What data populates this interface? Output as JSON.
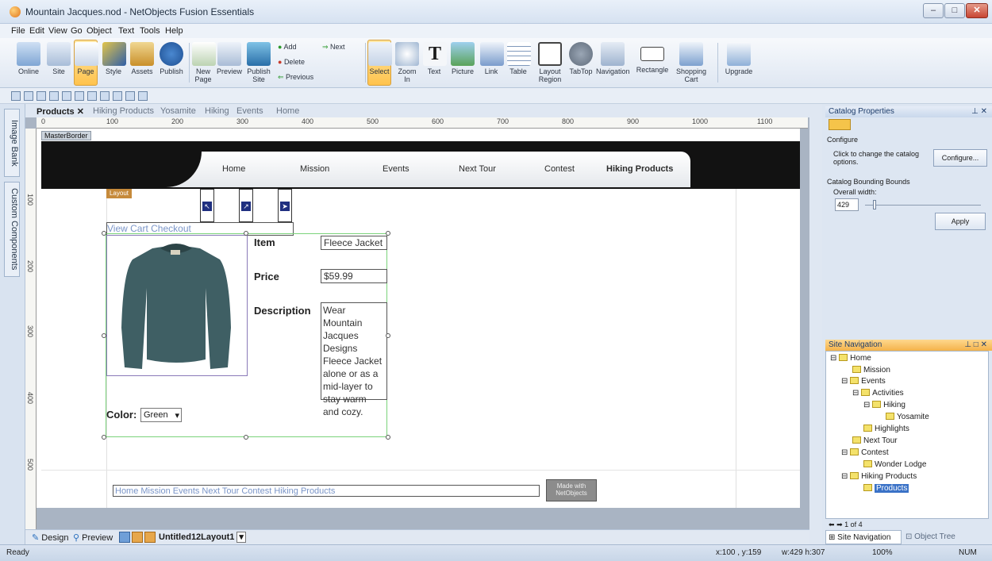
{
  "app": {
    "title": "Mountain Jacques.nod - NetObjects Fusion Essentials"
  },
  "menu": [
    "File",
    "Edit",
    "View",
    "Go",
    "Object",
    "Text",
    "Tools",
    "Help"
  ],
  "ribbon": {
    "left_buttons": [
      "Online",
      "Site",
      "Page",
      "Style",
      "Assets",
      "Publish"
    ],
    "page_buttons": [
      "New Page",
      "Preview",
      "Publish Site"
    ],
    "add_label": "Add",
    "delete_label": "Delete",
    "next_label": "Next",
    "previous_label": "Previous",
    "tools": [
      "Select",
      "Zoom In",
      "Text",
      "Picture",
      "Link",
      "Table",
      "Layout Region",
      "TabTop",
      "Navigation",
      "Rectangle",
      "Shopping Cart"
    ],
    "upgrade": "Upgrade"
  },
  "sidebar_tabs": [
    "Image Bank",
    "Custom Components"
  ],
  "doc_tabs": [
    "Products",
    "Hiking Products",
    "Yosamite",
    "Hiking",
    "Events",
    "Home"
  ],
  "ruler": {
    "h": [
      "0",
      "100",
      "200",
      "300",
      "400",
      "500",
      "600",
      "700",
      "800",
      "900",
      "1000",
      "1100"
    ],
    "v": [
      "100",
      "200",
      "300",
      "400",
      "500"
    ]
  },
  "page": {
    "masterborder_label": "MasterBorder",
    "layout_label": "Layout",
    "nav": [
      "Home",
      "Mission",
      "Events",
      "Next Tour",
      "Contest",
      "Hiking Products"
    ],
    "cart_links": "View Cart  Checkout",
    "item_label": "Item",
    "item_value": "Fleece Jacket",
    "price_label": "Price",
    "price_value": "$59.99",
    "description_label": "Description",
    "description_value": "Wear Mountain Jacques Designs Fleece Jacket alone or as a mid-layer to stay warm and cozy.",
    "color_label": "Color:",
    "color_value": "Green",
    "footer_links": "Home  Mission  Events  Next Tour  Contest  Hiking Products",
    "badge": "Made with NetObjects"
  },
  "bottom": {
    "design": "Design",
    "preview": "Preview",
    "layout_select": "Untitled12Layout1"
  },
  "catalog": {
    "title": "Catalog Properties",
    "configure_header": "Configure",
    "configure_text": "Click to change the catalog options.",
    "configure_button": "Configure...",
    "bounds_header": "Catalog Bounding Bounds",
    "overall_width_label": "Overall width:",
    "overall_width_value": "429",
    "apply_button": "Apply"
  },
  "site_nav": {
    "title": "Site Navigation",
    "tree": [
      "Home",
      "Mission",
      "Events",
      "Activities",
      "Hiking",
      "Yosamite",
      "Highlights",
      "Next Tour",
      "Contest",
      "Wonder Lodge",
      "Hiking Products",
      "Products"
    ],
    "pager": "1 of 4",
    "tab_site_nav": "Site Navigation",
    "tab_object_tree": "Object Tree"
  },
  "status": {
    "ready": "Ready",
    "coords": "x:100 , y:159",
    "size": "w:429 h:307",
    "zoom": "100%",
    "num": "NUM"
  },
  "colors": {
    "accent": "#ffc34d",
    "selection": "#3a72c7",
    "nav_header": "#f4b24a"
  }
}
